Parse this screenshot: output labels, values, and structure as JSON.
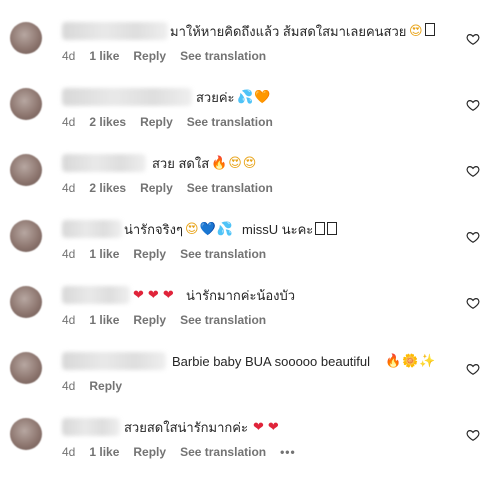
{
  "comments": [
    {
      "text": "มาให้หายคิดถึงแล้ว ส้มสดใสมาเลยคนสวย",
      "emojis": "😍",
      "time": "4d",
      "likes": "1 like",
      "reply": "Reply",
      "translate": "See translation"
    },
    {
      "text": "สวยค่ะ",
      "emojis": "💦🧡",
      "time": "4d",
      "likes": "2 likes",
      "reply": "Reply",
      "translate": "See translation"
    },
    {
      "text": "สวย สดใส",
      "emojis": "🔥😍😍",
      "time": "4d",
      "likes": "2 likes",
      "reply": "Reply",
      "translate": "See translation"
    },
    {
      "text": "น่ารักจริงๆ",
      "emojis": "😍💙💦",
      "text2": "missU นะคะ",
      "time": "4d",
      "likes": "1 like",
      "reply": "Reply",
      "translate": "See translation"
    },
    {
      "text": "น่ารักมากค่ะน้องบัว",
      "emojis": "❤️❤️❤️",
      "time": "4d",
      "likes": "1 like",
      "reply": "Reply",
      "translate": "See translation"
    },
    {
      "text": "Barbie baby BUA sooooo beautiful",
      "emojis": "🔥🌼✨",
      "time": "4d",
      "reply": "Reply"
    },
    {
      "text": "สวยสดใสน่ารักมากค่ะ",
      "emojis": "❤️❤️",
      "time": "4d",
      "likes": "1 like",
      "reply": "Reply",
      "translate": "See translation",
      "more": "•••"
    }
  ],
  "icons": {
    "like": "heart-outline-icon"
  },
  "colors": {
    "meta_text": "#737373",
    "body_text": "#262626"
  }
}
